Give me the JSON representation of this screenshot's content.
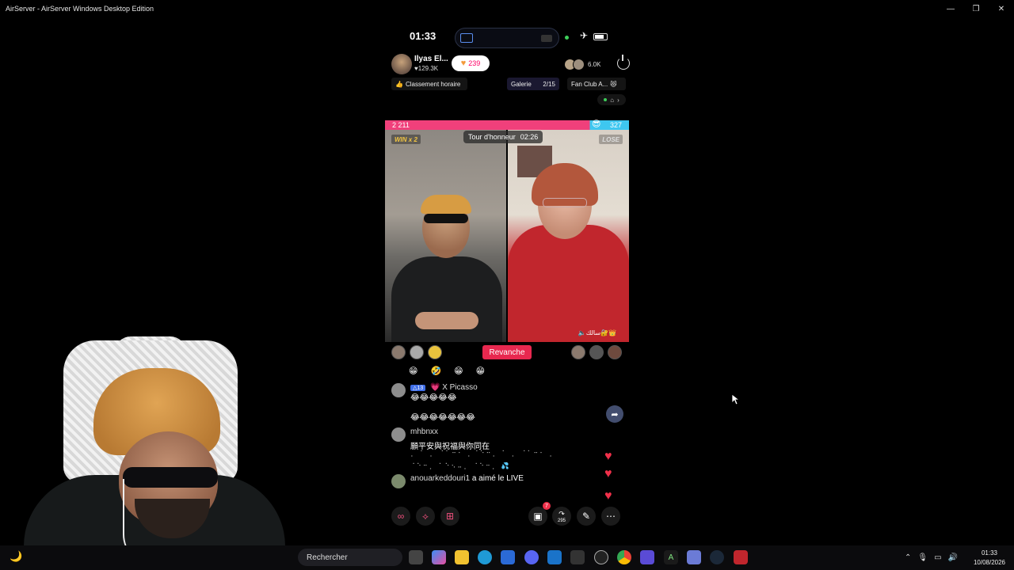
{
  "window": {
    "title": "AirServer - AirServer Windows Desktop Edition",
    "minimize": "—",
    "maximize": "❐",
    "close": "✕"
  },
  "phone": {
    "status": {
      "time": "01:33"
    },
    "host": {
      "name": "Ilyas El...",
      "likes": "♥129.3K",
      "follow_count": "239",
      "viewer_count": "6.0K"
    },
    "chips": {
      "ranking": "Classement horaire",
      "gallery": "Galerie",
      "gallery_count": "2/15",
      "fanclub": "Fan Club A..."
    },
    "battle": {
      "score_left": "2 211",
      "score_right": "327",
      "win_badge": "WIN x 2",
      "lose_badge": "LOSE",
      "honor_label": "Tour d'honneur",
      "honor_timer": "02:26",
      "overlay_text": "🔈سالك🔐👑"
    },
    "revanche_label": "Revanche",
    "chat": {
      "emoji_line": "😁🤣😁😁",
      "messages": [
        {
          "level": "△13",
          "user": "X Picasso",
          "text": "😂😂😂😂😂",
          "text2": "😂😂😂😂😂😂😂"
        },
        {
          "user": "mhbnxx",
          "text": "願平安與祝福與你同在"
        },
        {
          "user": "anouarkeddouri1",
          "text": "a aimé le LIVE"
        }
      ]
    },
    "bottom": {
      "badge_count": "7",
      "share_count": "295"
    }
  },
  "taskbar": {
    "search_placeholder": "Rechercher",
    "time": "01:33",
    "date": "10/08/2026"
  },
  "colors": {
    "accent": "#e8284f",
    "score_pink": "#f0407b",
    "score_blue": "#3ec7f0"
  }
}
